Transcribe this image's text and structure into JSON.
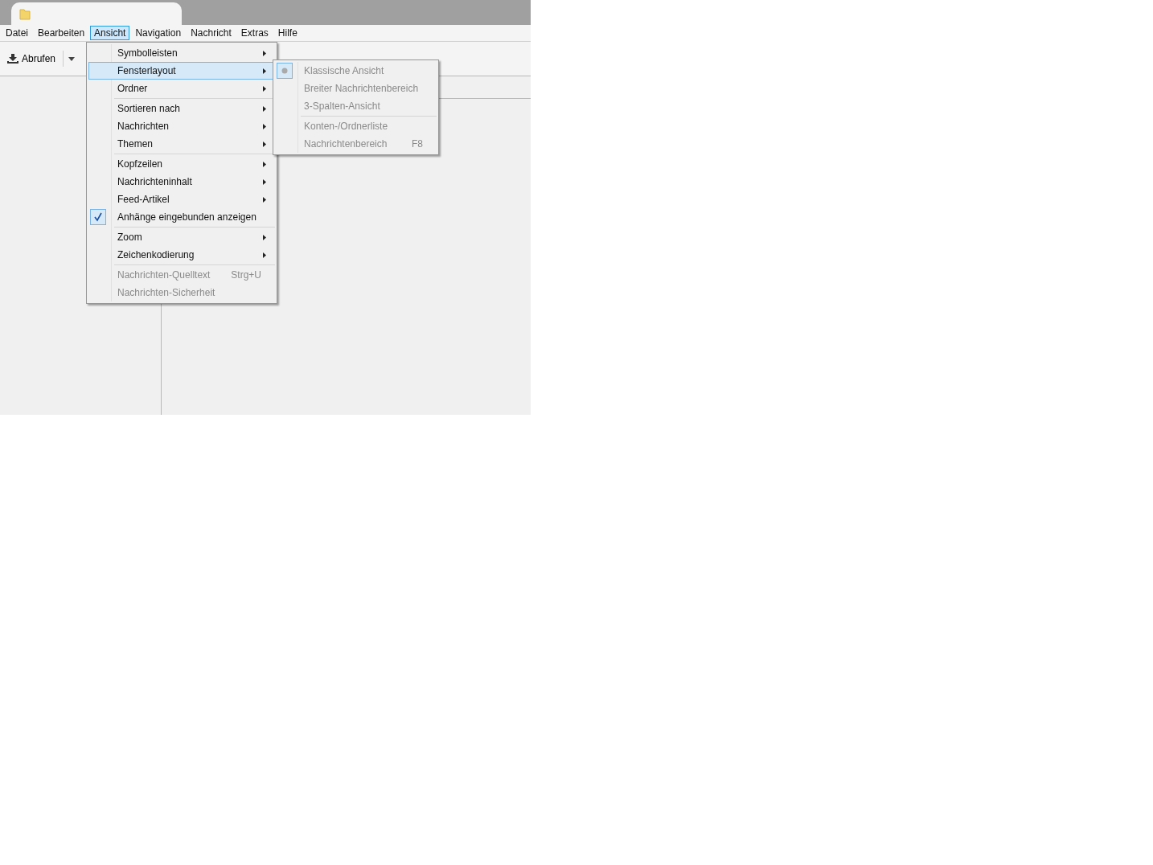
{
  "menu_bar": [
    {
      "label": "Datei",
      "selected": false
    },
    {
      "label": "Bearbeiten",
      "selected": false
    },
    {
      "label": "Ansicht",
      "selected": true
    },
    {
      "label": "Navigation",
      "selected": false
    },
    {
      "label": "Nachricht",
      "selected": false
    },
    {
      "label": "Extras",
      "selected": false
    },
    {
      "label": "Hilfe",
      "selected": false
    }
  ],
  "toolbar": {
    "get_button": "Abrufen"
  },
  "view_menu": {
    "items": [
      {
        "kind": "item",
        "label": "Symbolleisten",
        "submenu": true,
        "checked": false,
        "disabled": false,
        "selected": false
      },
      {
        "kind": "item",
        "label": "Fensterlayout",
        "submenu": true,
        "checked": false,
        "disabled": false,
        "selected": true
      },
      {
        "kind": "item",
        "label": "Ordner",
        "submenu": true,
        "checked": false,
        "disabled": false,
        "selected": false
      },
      {
        "kind": "separator"
      },
      {
        "kind": "item",
        "label": "Sortieren nach",
        "submenu": true,
        "checked": false,
        "disabled": false,
        "selected": false
      },
      {
        "kind": "item",
        "label": "Nachrichten",
        "submenu": true,
        "checked": false,
        "disabled": false,
        "selected": false
      },
      {
        "kind": "item",
        "label": "Themen",
        "submenu": true,
        "checked": false,
        "disabled": false,
        "selected": false
      },
      {
        "kind": "separator"
      },
      {
        "kind": "item",
        "label": "Kopfzeilen",
        "submenu": true,
        "checked": false,
        "disabled": false,
        "selected": false
      },
      {
        "kind": "item",
        "label": "Nachrichteninhalt",
        "submenu": true,
        "checked": false,
        "disabled": false,
        "selected": false
      },
      {
        "kind": "item",
        "label": "Feed-Artikel",
        "submenu": true,
        "checked": false,
        "disabled": false,
        "selected": false
      },
      {
        "kind": "item",
        "label": "Anhänge eingebunden anzeigen",
        "submenu": false,
        "checked": true,
        "disabled": false,
        "selected": false
      },
      {
        "kind": "separator"
      },
      {
        "kind": "item",
        "label": "Zoom",
        "submenu": true,
        "checked": false,
        "disabled": false,
        "selected": false
      },
      {
        "kind": "item",
        "label": "Zeichenkodierung",
        "submenu": true,
        "checked": false,
        "disabled": false,
        "selected": false
      },
      {
        "kind": "separator"
      },
      {
        "kind": "item",
        "label": "Nachrichten-Quelltext",
        "shortcut": "Strg+U",
        "submenu": false,
        "checked": false,
        "disabled": true,
        "selected": false
      },
      {
        "kind": "item",
        "label": "Nachrichten-Sicherheit",
        "submenu": false,
        "checked": false,
        "disabled": true,
        "selected": false
      }
    ]
  },
  "layout_submenu": {
    "items": [
      {
        "kind": "item",
        "label": "Klassische Ansicht",
        "radio": true,
        "disabled": true
      },
      {
        "kind": "item",
        "label": "Breiter Nachrichtenbereich",
        "radio": false,
        "disabled": true
      },
      {
        "kind": "item",
        "label": "3-Spalten-Ansicht",
        "radio": false,
        "disabled": true
      },
      {
        "kind": "separator"
      },
      {
        "kind": "item",
        "label": "Konten-/Ordnerliste",
        "radio": false,
        "disabled": true
      },
      {
        "kind": "item",
        "label": "Nachrichtenbereich",
        "shortcut": "F8",
        "radio": false,
        "disabled": true
      }
    ]
  }
}
